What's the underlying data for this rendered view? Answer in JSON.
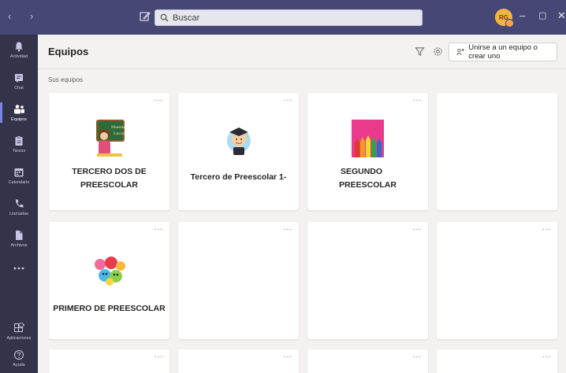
{
  "titlebar": {
    "nav_arrows": "‹ ›",
    "search_placeholder": "Buscar",
    "avatar_initials": "RG"
  },
  "rail": [
    {
      "name": "rail-item-actividad",
      "label": "Actividad",
      "icon": "bell-icon",
      "active": false
    },
    {
      "name": "rail-item-chat",
      "label": "Chat",
      "icon": "chat-icon",
      "active": false
    },
    {
      "name": "rail-item-equipos",
      "label": "Equipos",
      "icon": "teams-icon",
      "active": true
    },
    {
      "name": "rail-item-tareas",
      "label": "Tareas",
      "icon": "assignments-icon",
      "active": false
    },
    {
      "name": "rail-item-calendario",
      "label": "Calendario",
      "icon": "calendar-icon",
      "active": false
    },
    {
      "name": "rail-item-llamadas",
      "label": "Llamadas",
      "icon": "phone-icon",
      "active": false
    },
    {
      "name": "rail-item-archivos",
      "label": "Archivos",
      "icon": "file-icon",
      "active": false
    },
    {
      "name": "rail-item-mas",
      "label": "",
      "icon": "more-icon",
      "active": false
    },
    {
      "name": "rail-item-aplicaciones",
      "label": "Aplicaciones",
      "icon": "apps-icon",
      "active": false
    },
    {
      "name": "rail-item-ayuda",
      "label": "Ayuda",
      "icon": "help-icon",
      "active": false
    }
  ],
  "header": {
    "title": "Equipos",
    "join_label": "Unirse a un equipo o crear uno"
  },
  "section_label": "Sus equipos",
  "cards": [
    {
      "name_line1": "TERCERO DOS DE",
      "name_line2": "PREESCOLAR",
      "image": "teacher-chalkboard-image"
    },
    {
      "name_line1": "Tercero de Preescolar 1-",
      "name_line2": "",
      "image": "graduate-boy-image"
    },
    {
      "name_line1": "SEGUNDO",
      "name_line2": "PREESCOLAR",
      "image": "colored-pencils-image"
    },
    {
      "name_line1": "",
      "name_line2": "",
      "image": ""
    },
    {
      "name_line1": "PRIMERO DE PREESCOLAR",
      "name_line2": "",
      "image": "cartoon-characters-image"
    }
  ],
  "more_label": "···",
  "colors": {
    "titlebar": "#464775",
    "rail": "#33344a",
    "accent": "#7b83eb",
    "background": "#f3f2f1"
  }
}
